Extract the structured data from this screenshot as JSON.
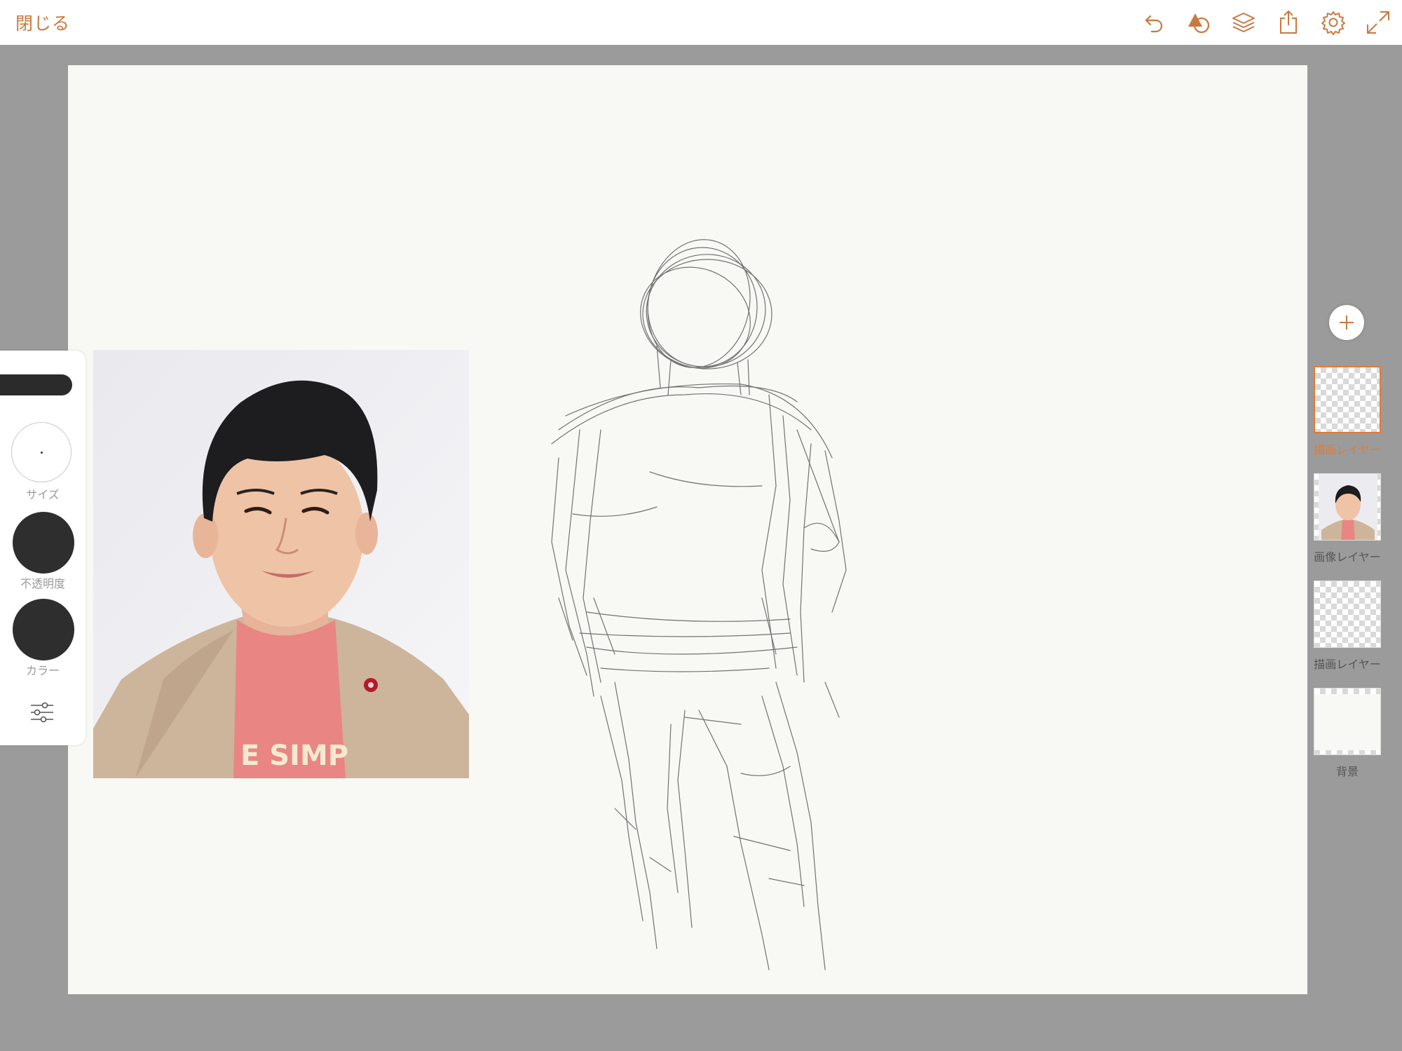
{
  "header": {
    "close_label": "閉じる",
    "icons": [
      "undo-icon",
      "shapes-icon",
      "layers-icon",
      "share-icon",
      "settings-icon",
      "fullscreen-icon"
    ],
    "accent_color": "#c8793f"
  },
  "reference_photo": {
    "shirt_text": "E SIMP"
  },
  "tool_panel": {
    "size_label": "サイズ",
    "opacity_label": "不透明度",
    "color_label": "カラー",
    "brush_color": "#2e2e2e"
  },
  "layers": {
    "add_icon": "plus-icon",
    "items": [
      {
        "name": "描画レイヤー",
        "active": true
      },
      {
        "name": "画像レイヤー",
        "active": false
      },
      {
        "name": "描画レイヤー",
        "active": false
      },
      {
        "name": "背景",
        "active": false
      }
    ]
  }
}
